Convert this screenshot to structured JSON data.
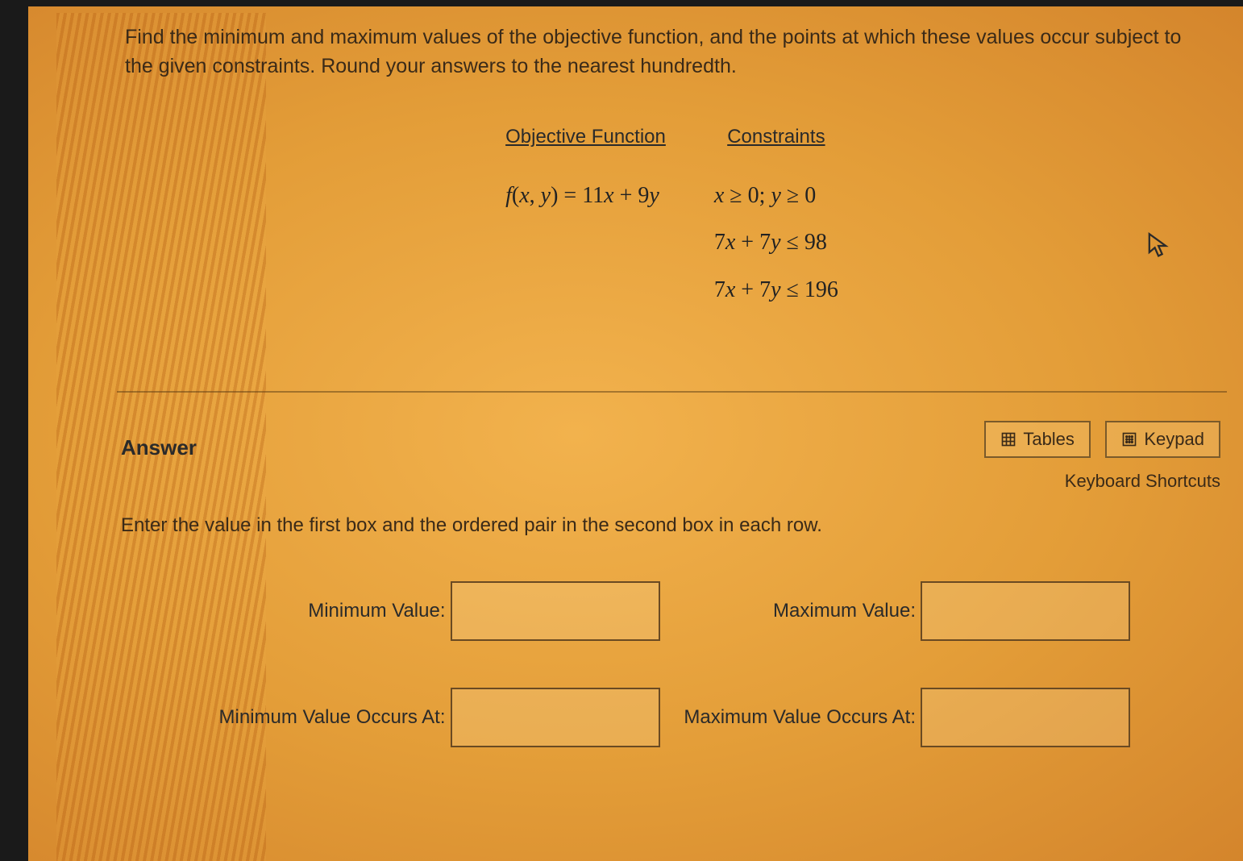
{
  "question": "Find the minimum and maximum values of the objective function, and the points at which these values occur subject to the given constraints. Round your answers to the nearest hundredth.",
  "headers": {
    "objective": "Objective Function",
    "constraints": "Constraints"
  },
  "objective_function": "f(x, y) = 11x + 9y",
  "constraints": {
    "c1": "x ≥ 0; y ≥ 0",
    "c2": "7x + 7y ≤ 98",
    "c3": "7x + 7y ≤ 196"
  },
  "answer": {
    "title": "Answer",
    "buttons": {
      "tables": "Tables",
      "keypad": "Keypad"
    },
    "shortcut": "Keyboard Shortcuts",
    "instruction": "Enter the value in the first box and the ordered pair in the second box in each row.",
    "labels": {
      "min_value": "Minimum Value:",
      "max_value": "Maximum Value:",
      "min_at": "Minimum Value Occurs At:",
      "max_at": "Maximum Value Occurs At:"
    },
    "values": {
      "min_value": "",
      "max_value": "",
      "min_at": "",
      "max_at": ""
    }
  }
}
